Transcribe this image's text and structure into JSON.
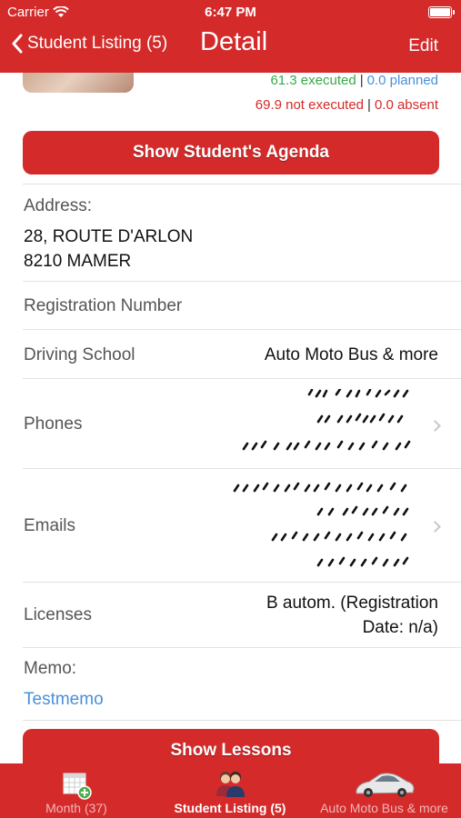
{
  "status_bar": {
    "carrier": "Carrier",
    "time": "6:47 PM"
  },
  "nav": {
    "back_label": "Student Listing (5)",
    "title": "Detail",
    "edit_label": "Edit"
  },
  "stats": {
    "executed": "61.3 executed",
    "planned": "0.0 planned",
    "not_executed": "69.9 not executed",
    "absent": "0.0 absent",
    "separator": "|"
  },
  "buttons": {
    "agenda": "Show Student's Agenda",
    "lessons": "Show Lessons"
  },
  "address": {
    "label": "Address:",
    "line1": "28, ROUTE D'ARLON",
    "line2": "8210 MAMER"
  },
  "registration": {
    "label": "Registration Number"
  },
  "driving_school": {
    "label": "Driving School",
    "value": "Auto Moto Bus & more"
  },
  "phones": {
    "label": "Phones"
  },
  "emails": {
    "label": "Emails"
  },
  "licenses": {
    "label": "Licenses",
    "value_line1": "B autom. (Registration",
    "value_line2": "Date: n/a)"
  },
  "memo": {
    "label": "Memo:",
    "value": "Testmemo"
  },
  "tabs": [
    {
      "label": "Month (37)",
      "icon": "calendar-icon",
      "active": false
    },
    {
      "label": "Student Listing (5)",
      "icon": "students-icon",
      "active": true
    },
    {
      "label": "Auto Moto Bus & more",
      "icon": "car-icon",
      "active": false
    }
  ],
  "colors": {
    "brand_red": "#d42a2a",
    "executed_green": "#3aa94a",
    "link_blue": "#4a90d9"
  }
}
